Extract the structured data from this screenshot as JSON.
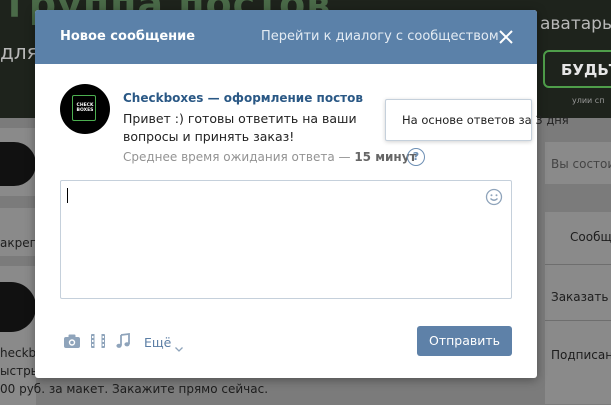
{
  "background": {
    "cover_title": "группа постов",
    "cover_left": "для",
    "cover_right": "аватары",
    "cover_button": "БУДЬТ",
    "cover_small": "улии сп",
    "search_placeholder": "Вы состоит",
    "pinned_tab": "акреп",
    "right_items": [
      "Сообщ",
      "Заказать",
      "Подписаны"
    ],
    "post_lines": [
      "heckbox",
      "ыстрые",
      "00 руб. за макет. Закажите прямо сейчас."
    ]
  },
  "modal": {
    "title": "Новое сообщение",
    "dialog_link": "Перейти к диалогу с сообществом",
    "community": {
      "logo_text": "CHECK BOXES",
      "name": "Checkboxes — оформление постов",
      "greeting": "Привет :) готовы ответить на ваши вопросы и принять заказ!",
      "wait_prefix": "Среднее время ожидания ответа —",
      "wait_value": "15 минут",
      "help_symbol": "?"
    },
    "tooltip": "На основе ответов за 3 дня",
    "message": {
      "value": "",
      "placeholder": ""
    },
    "toolbar": {
      "more_label": "Ещё",
      "send_label": "Отправить"
    }
  },
  "colors": {
    "header_bg": "#5b81a9",
    "link": "#2a5885",
    "send_button": "#5e81a8",
    "logo_accent": "#4caf50"
  },
  "icons": [
    "close-icon",
    "photo-icon",
    "video-icon",
    "music-icon",
    "chevron-down-icon",
    "emoji-icon",
    "help-icon"
  ]
}
